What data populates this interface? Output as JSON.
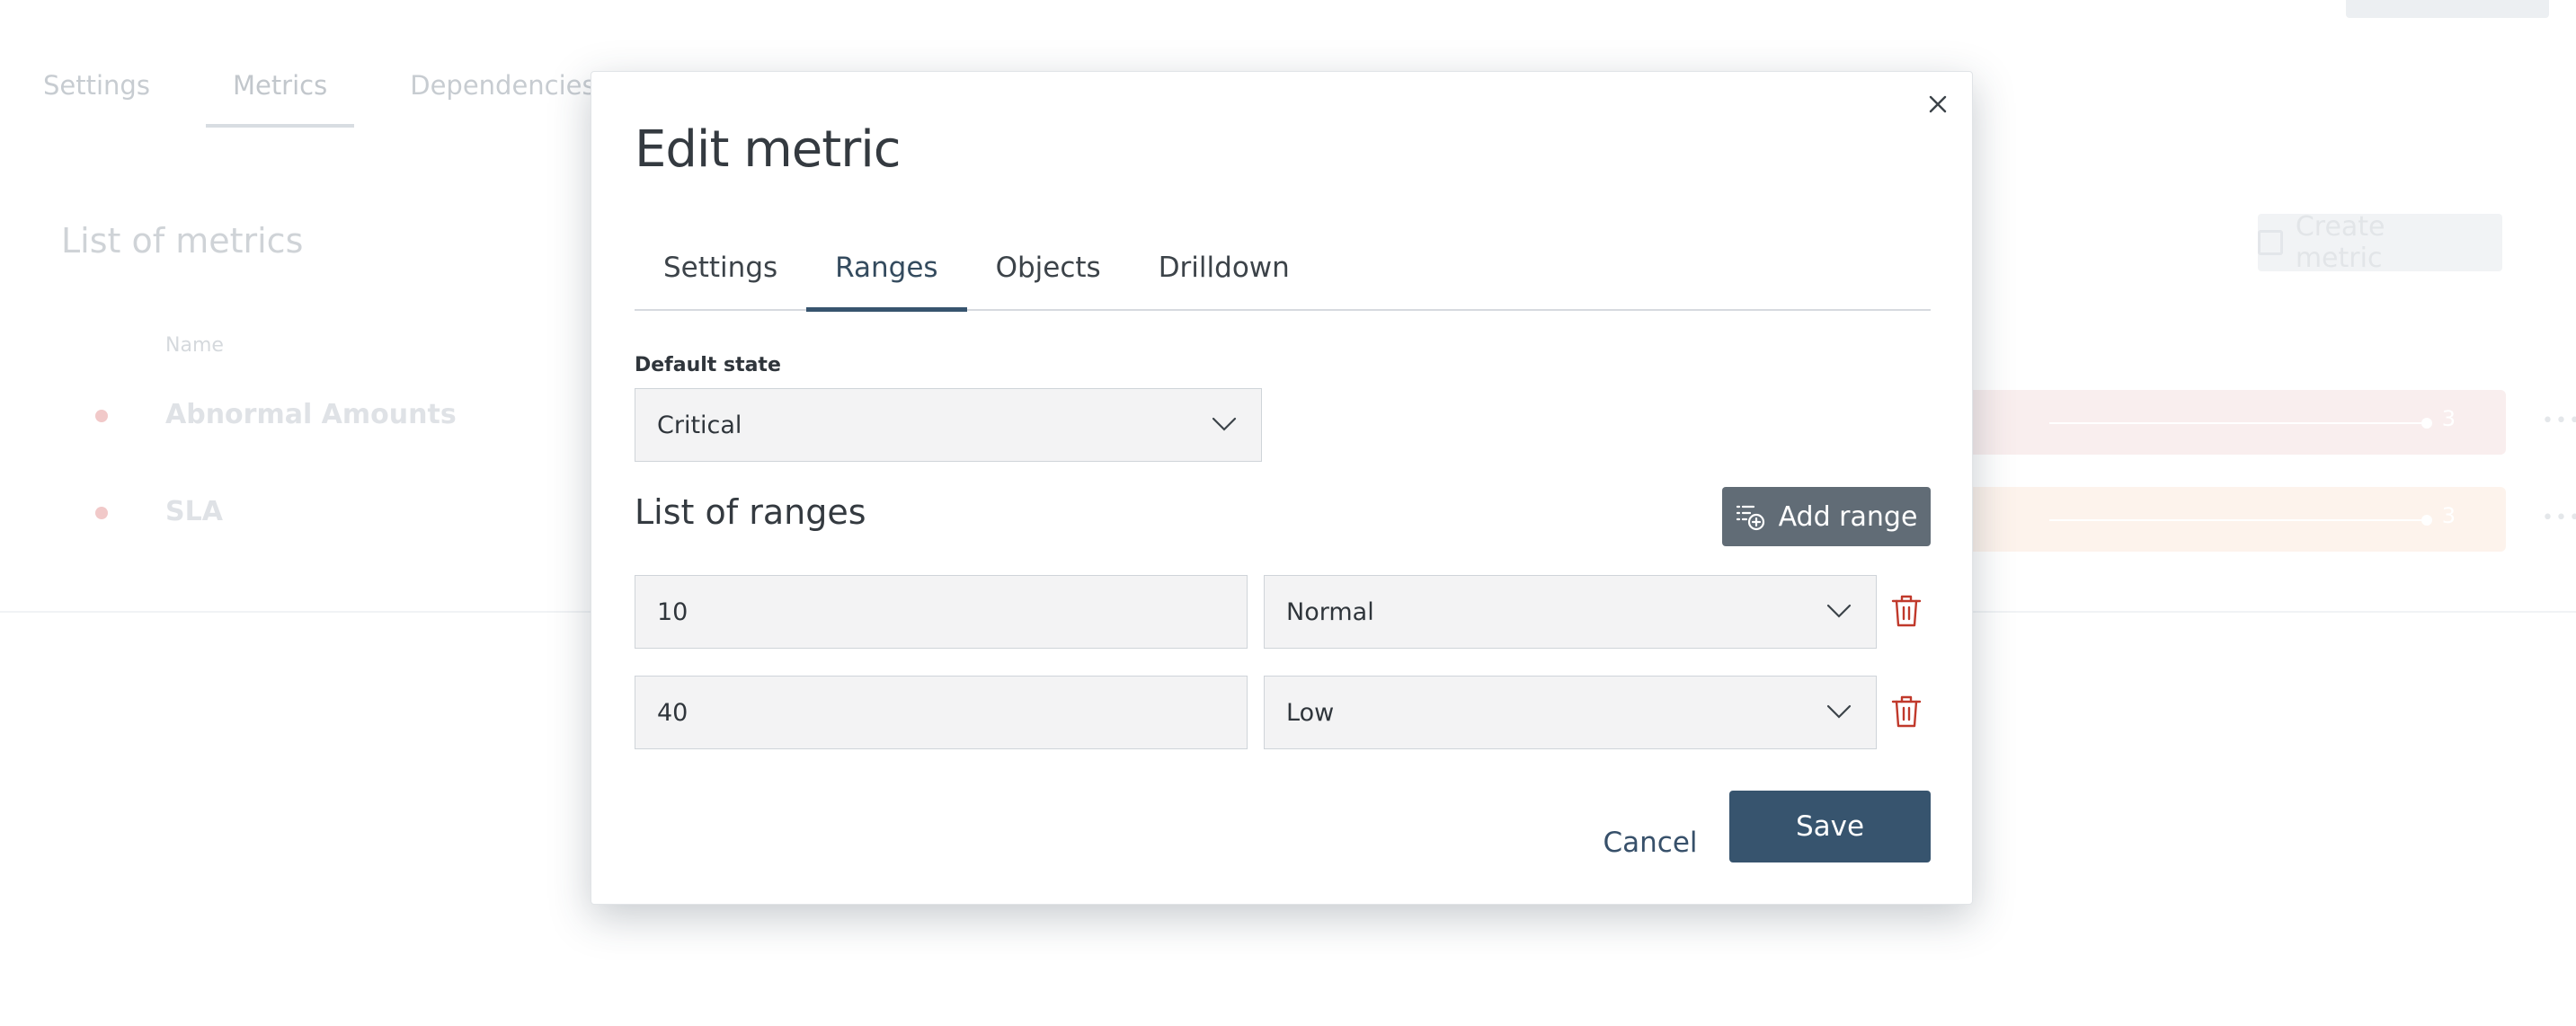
{
  "background": {
    "tabs": [
      {
        "label": "Settings"
      },
      {
        "label": "Metrics"
      },
      {
        "label": "Dependencies"
      }
    ],
    "list_title": "List of metrics",
    "create_button": "Create metric",
    "column_name": "Name",
    "rows": [
      {
        "name": "Abnormal Amounts",
        "value": "3",
        "more": "•••",
        "bar_color": "#f9eeee"
      },
      {
        "name": "SLA",
        "value": "3",
        "more": "•••",
        "bar_color": "#fdf3ec"
      }
    ]
  },
  "dialog": {
    "title": "Edit metric",
    "close_icon": "close-icon",
    "tabs": [
      {
        "label": "Settings",
        "active": false
      },
      {
        "label": "Ranges",
        "active": true
      },
      {
        "label": "Objects",
        "active": false
      },
      {
        "label": "Drilldown",
        "active": false
      }
    ],
    "default_state": {
      "label": "Default state",
      "value": "Critical"
    },
    "ranges_section": {
      "title": "List of ranges",
      "add_button": "Add range",
      "ranges": [
        {
          "threshold": "10",
          "state": "Normal"
        },
        {
          "threshold": "40",
          "state": "Low"
        }
      ]
    },
    "cancel_label": "Cancel",
    "save_label": "Save"
  },
  "colors": {
    "primary": "#37546e",
    "add_button": "#616c76",
    "delete": "#c0392b",
    "field_bg": "#f3f3f4"
  }
}
